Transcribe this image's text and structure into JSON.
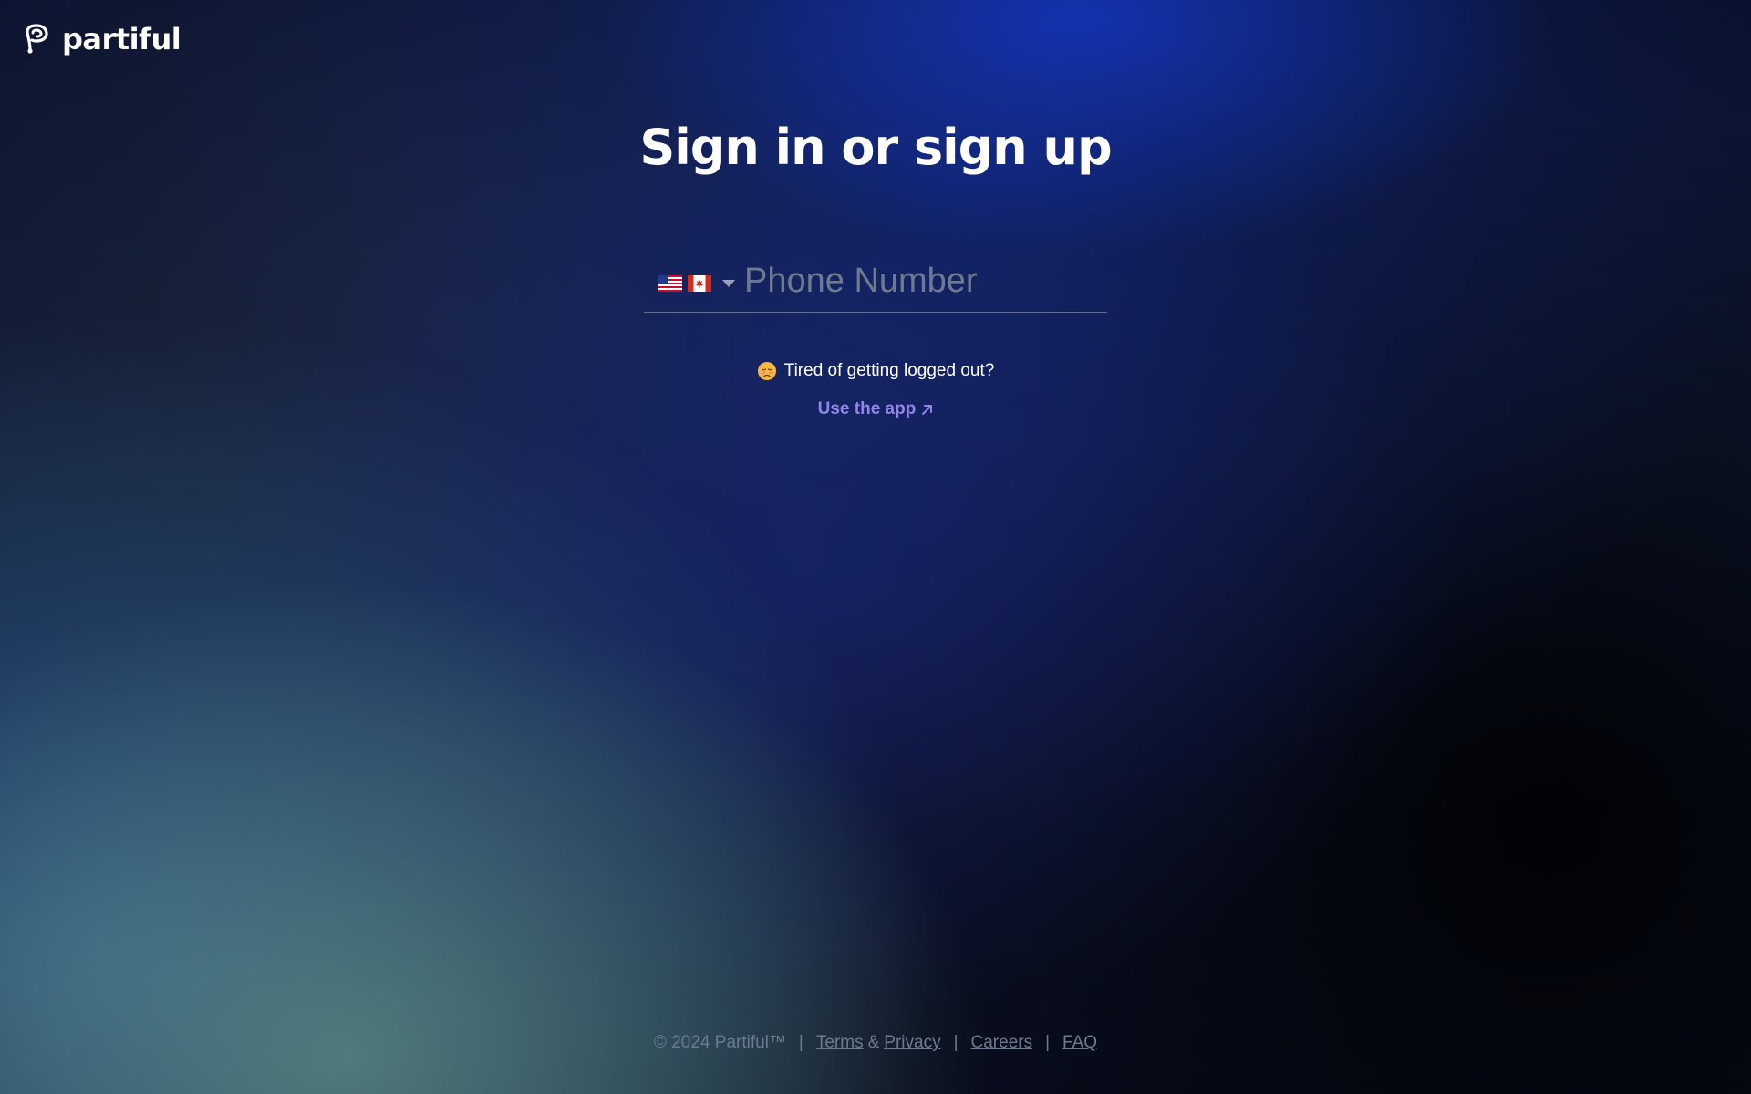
{
  "brand": {
    "name": "partiful"
  },
  "auth": {
    "title": "Sign in or sign up",
    "country_select": {
      "flags": [
        "us-flag-icon",
        "canada-flag-icon"
      ]
    },
    "phone": {
      "value": "",
      "placeholder": "Phone Number"
    },
    "tired_text": "Tired of getting logged out?",
    "use_app_label": "Use the app"
  },
  "footer": {
    "copyright": "© 2024 Partiful™",
    "separator": "|",
    "terms": "Terms",
    "amp": "&",
    "privacy": "Privacy",
    "careers": "Careers",
    "faq": "FAQ"
  },
  "colors": {
    "link_accent": "#8f86e8",
    "footer_text": "#6d7a8e"
  }
}
